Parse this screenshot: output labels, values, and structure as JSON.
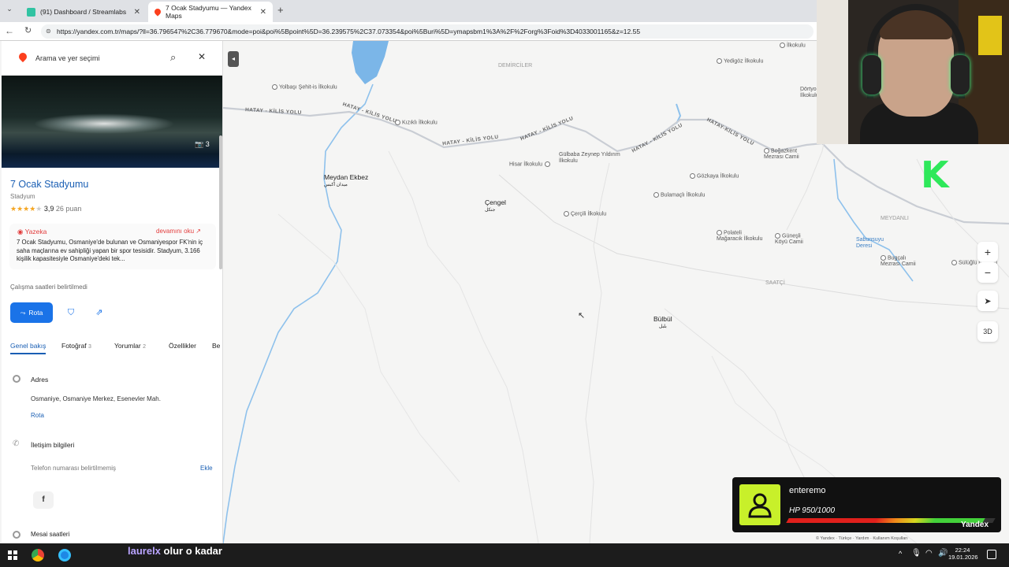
{
  "browser": {
    "tabs": [
      {
        "label": "(91) Dashboard / Streamlabs",
        "icon": "streamlabs-icon",
        "active": false
      },
      {
        "label": "7 Ocak Stadyumu — Yandex Maps",
        "icon": "yandex-maps-pin-icon",
        "active": true
      }
    ],
    "new_tab": "+",
    "url": "https://yandex.com.tr/maps/?ll=36.796547%2C36.779670&mode=poi&poi%5Bpoint%5D=36.239575%2C37.073354&poi%5Buri%5D=ymapsbm1%3A%2F%2Forg%3Foid%3D4033001165&z=12.55"
  },
  "panel": {
    "search_placeholder": "Arama ve yer seçimi",
    "photo_count": "3",
    "title": "7 Ocak Stadyumu",
    "category": "Stadyum",
    "rating": "3,9",
    "rating_count": "26 puan",
    "stars_filled": 4,
    "ai_label": "Yazeka",
    "read_more": "devamını oku ↗",
    "description": "7 Ocak Stadyumu, Osmaniye'de bulunan ve Osmaniyespor FK'nin iç saha maçlarına ev sahipliği yapan bir spor tesisidir. Stadyum, 3.166 kişilik kapasitesiyle Osmaniye'deki tek...",
    "hours_note": "Çalışma saatleri belirtilmedi",
    "route_button": "Rota",
    "tabs": [
      {
        "label": "Genel bakış",
        "count": ""
      },
      {
        "label": "Fotoğraf",
        "count": "3"
      },
      {
        "label": "Yorumlar",
        "count": "2"
      },
      {
        "label": "Özellikler",
        "count": ""
      },
      {
        "label": "Be",
        "count": ""
      }
    ],
    "address_heading": "Adres",
    "address": "Osmaniye, Osmaniye Merkez, Esenevler Mah.",
    "address_route": "Rota",
    "contact_heading": "İletişim bilgileri",
    "phone_note": "Telefon numarası belirtilmemiş",
    "add_label": "Ekle",
    "hours_heading": "Mesai saatleri"
  },
  "map": {
    "roads": [
      "HATAY - KİLİS YOLU",
      "HATAY - KİLİS YOLU",
      "HATAY - KİLİS YOLU",
      "HATAY - KİLİS YOLU",
      "HATAY - KİLİS YOLU",
      "HATAY-KİLİS YOLU"
    ],
    "places": [
      {
        "name": "Yolbaşı Şehit-is İlkokulu"
      },
      {
        "name": "Kızıklı İlkokulu"
      },
      {
        "name": "Meydan Ekbez"
      },
      {
        "name": "Çengel"
      },
      {
        "name": "Hisar İlkokulu"
      },
      {
        "name": "Gülbaba Zeynep Yıldırım İlkokulu"
      },
      {
        "name": "Çerçili İlkokulu"
      },
      {
        "name": "Gözkaya İlkokulu"
      },
      {
        "name": "Bulamaçlı İlkokulu"
      },
      {
        "name": "Yedigöz İlkokulu"
      },
      {
        "name": "Boğazkent Mezrası Camii"
      },
      {
        "name": "Polateli Mağaracık İlkokulu"
      },
      {
        "name": "Güneşli Köyü Camii"
      },
      {
        "name": "Sabunsuyu Deresi"
      },
      {
        "name": "Bugçalı Mezrası Camii"
      },
      {
        "name": "Bülbül"
      },
      {
        "name": "DEMİRCİLER"
      },
      {
        "name": "MEYDANLI"
      },
      {
        "name": "SAATÇİ"
      },
      {
        "name": "İlkokulu"
      },
      {
        "name": "Dörtyol İlkokulu"
      },
      {
        "name": "Sülüğlü İlkokulu"
      }
    ],
    "arabic_meydan": "ميدان أكبس",
    "arabic_cengel": "جنكل",
    "arabic_bulbul": "بلبل",
    "zoom_in": "+",
    "zoom_out": "−",
    "three_d": "3D",
    "brand": "Yandex",
    "footer_links": "© Yandex · Türkçe · Yardım · Kullanım Koşulları"
  },
  "stream_overlay": {
    "username": "enteremo",
    "hp_text": "HP 950/1000",
    "hp_fraction": 0.95,
    "chat_user": "laurelx",
    "chat_message": "olur o kadar",
    "logo_letter": "K"
  },
  "taskbar": {
    "time": "22:24",
    "date": "19.01.2026"
  },
  "colors": {
    "accent_blue": "#1a73e8",
    "yandex_red": "#fc3f1d",
    "tab_bar": "#dfe1e5",
    "hp_green": "#43d13a",
    "hp_red": "#e0201c",
    "badge_yellow": "#c8f02a",
    "water": "#7bb6e8"
  }
}
